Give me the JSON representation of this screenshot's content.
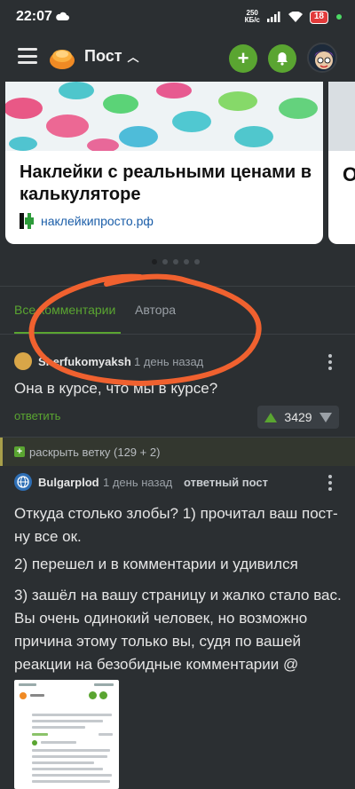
{
  "status_bar": {
    "time": "22:07",
    "net_speed_value": "250",
    "net_speed_unit": "КБ/с",
    "battery": "18"
  },
  "header": {
    "title": "Пост",
    "chevron": "^",
    "add_label": "+",
    "bell_icon": "bell-icon"
  },
  "carousel": {
    "card_title": "Наклейки с реальными ценами в калькуляторе",
    "card_source": "наклейкипросто.рф",
    "next_card_letter": "О",
    "pages": 5,
    "active_page": 1
  },
  "tabs": {
    "all_comments": "Все комментарии",
    "author": "Автора"
  },
  "comment1": {
    "username": "Sherfukomyaksh",
    "time": "1 день назад",
    "text": "Она в курсе, что мы в курсе?",
    "reply": "ответить",
    "score": "3429"
  },
  "expand": {
    "icon": "+",
    "label": "раскрыть ветку (129 + 2)"
  },
  "comment2": {
    "username": "Bulgarplod",
    "time": "1 день назад",
    "badge": "ответный пост",
    "p1": "Откуда столько злобы? 1) прочитал ваш пост- ну все ок.",
    "p2": "2) перешел и в комментарии и удивился",
    "p3": "3) зашёл на вашу страницу и жалко стало вас. Вы очень одинокий человек, но возможно причина этому только вы, судя по вашей реакции на безобидные комментарии @"
  },
  "colors": {
    "accent": "#5aa531",
    "annotation": "#f0612f",
    "background": "#2b2f32"
  }
}
